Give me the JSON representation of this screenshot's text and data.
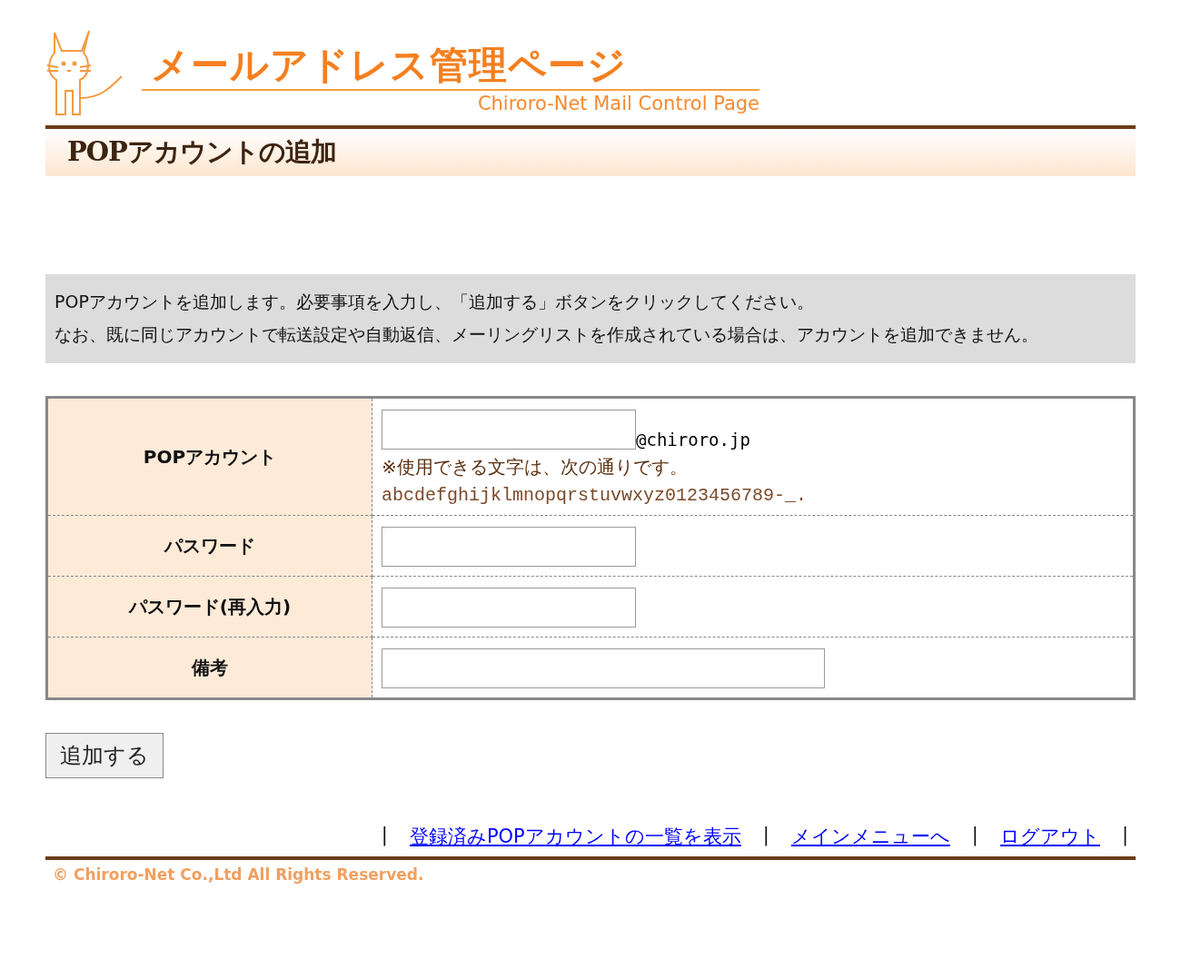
{
  "header": {
    "title": "メールアドレス管理ページ",
    "subtitle": "Chiroro-Net Mail Control Page"
  },
  "page_title": "POPアカウントの追加",
  "notice": [
    "POPアカウントを追加します。必要事項を入力し、「追加する」ボタンをクリックしてください。",
    "なお、既に同じアカウントで転送設定や自動返信、メーリングリストを作成されている場合は、アカウントを追加できません。"
  ],
  "form": {
    "rows": [
      {
        "label": "POPアカウント",
        "kind": "account",
        "suffix": "@chiroro.jp",
        "note": "※使用できる文字は、次の通りです。",
        "chars": "abcdefghijklmnopqrstuvwxyz0123456789-_."
      },
      {
        "label": "パスワード",
        "kind": "short"
      },
      {
        "label": "パスワード(再入力)",
        "kind": "short"
      },
      {
        "label": "備考",
        "kind": "wide"
      }
    ]
  },
  "submit": "追加する",
  "nav": {
    "separator": "|",
    "links": [
      "登録済みPOPアカウントの一覧を表示",
      "メインメニューへ",
      "ログアウト"
    ]
  },
  "copyright": "© Chiroro-Net Co.,Ltd All Rights Reserved."
}
